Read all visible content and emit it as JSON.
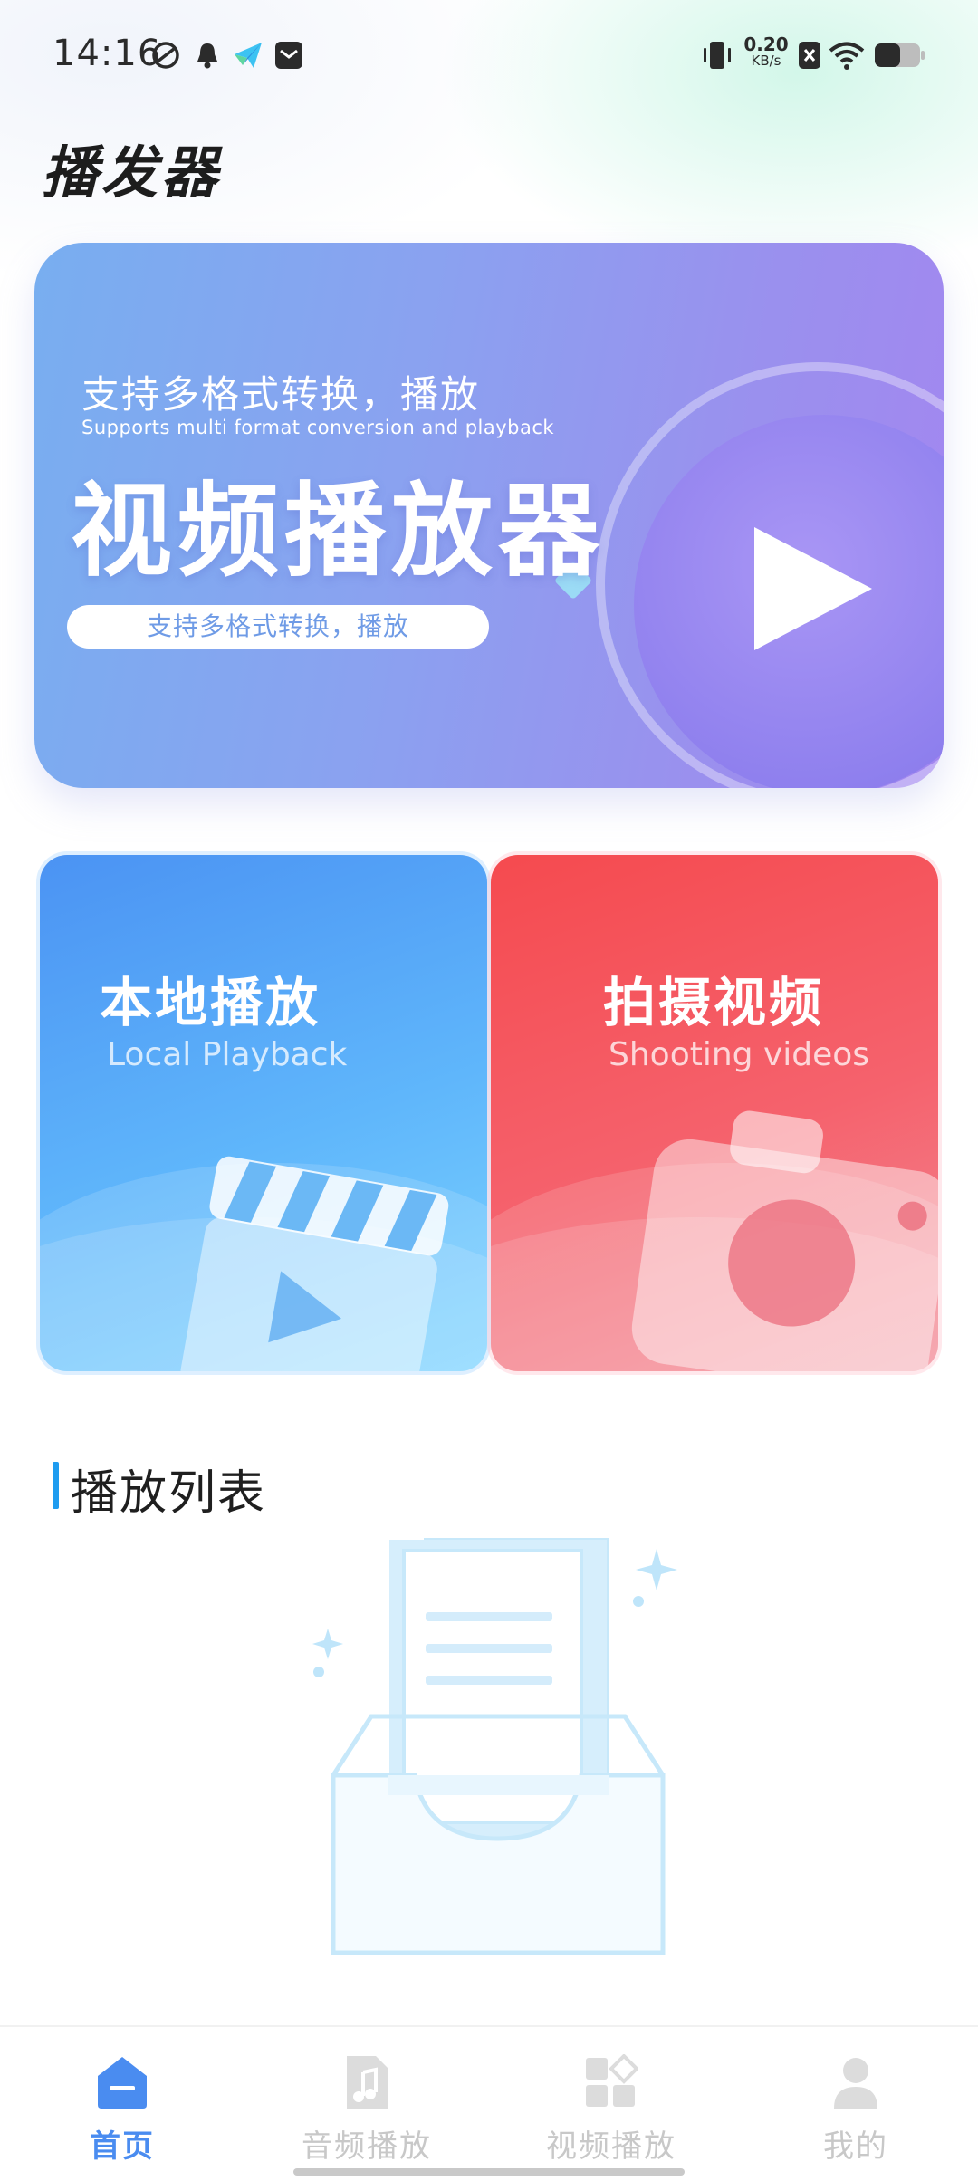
{
  "status_bar": {
    "time": "14:16",
    "net_speed_value": "0.20",
    "net_speed_unit": "KB/s",
    "left_icons": [
      "sync-icon",
      "bell-icon",
      "paper-plane-icon",
      "message-box-icon"
    ],
    "right_icons": [
      "vibrate-icon",
      "sim-x-icon",
      "wifi-icon",
      "battery-icon"
    ]
  },
  "header": {
    "title": "播发器"
  },
  "hero": {
    "subtitle_cn": "支持多格式转换，播放",
    "subtitle_en": "Supports multi format conversion and playback",
    "title": "视频播放器",
    "pill_text": "支持多格式转换，播放"
  },
  "cards": [
    {
      "title": "本地播放",
      "subtitle": "Local Playback",
      "icon": "clapperboard-icon"
    },
    {
      "title": "拍摄视频",
      "subtitle": "Shooting videos",
      "icon": "camera-icon"
    }
  ],
  "playlist": {
    "title": "播放列表",
    "empty_icon": "empty-inbox-icon"
  },
  "bottom_nav": {
    "items": [
      {
        "label": "首页",
        "icon": "home-icon",
        "active": true
      },
      {
        "label": "音频播放",
        "icon": "music-file-icon",
        "active": false
      },
      {
        "label": "视频播放",
        "icon": "video-grid-icon",
        "active": false
      },
      {
        "label": "我的",
        "icon": "user-icon",
        "active": false
      }
    ]
  },
  "colors": {
    "accent": "#4a8cf0",
    "section_bar": "#1e9cf0",
    "inactive_nav": "#c8c8c8",
    "card_blue": "#4b93f3",
    "card_red": "#f54a4f"
  }
}
